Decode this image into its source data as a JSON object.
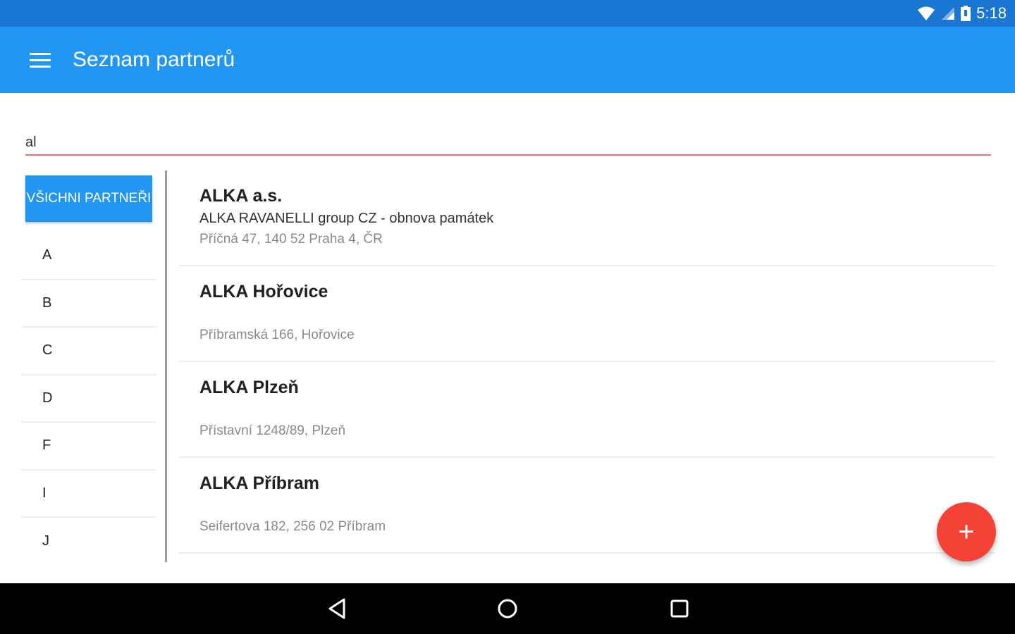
{
  "status_bar": {
    "time": "5:18",
    "icons": [
      "wifi-icon",
      "cellular-signal-icon",
      "battery-icon"
    ]
  },
  "toolbar": {
    "menu_icon": "hamburger-menu-icon",
    "title": "Seznam partnerů"
  },
  "search": {
    "value": "al",
    "placeholder": ""
  },
  "letters_panel": {
    "all_button": "VŠICHNI PARTNEŘI",
    "letters": [
      "A",
      "B",
      "C",
      "D",
      "F",
      "I",
      "J"
    ]
  },
  "partners": [
    {
      "name": "ALKA a.s.",
      "description": "ALKA RAVANELLI group CZ - obnova památek",
      "address": "Příčná 47, 140 52 Praha 4, ČR"
    },
    {
      "name": "ALKA Hořovice",
      "description": "",
      "address": "Příbramská 166,  Hořovice"
    },
    {
      "name": "ALKA Plzeň",
      "description": "",
      "address": "Přístavní 1248/89,  Plzeň"
    },
    {
      "name": "ALKA Příbram",
      "description": "",
      "address": "Seifertova 182, 256 02 Příbram"
    }
  ],
  "fab": {
    "icon": "plus-icon",
    "symbol": "+"
  },
  "nav_bar": {
    "icons": [
      "back-icon",
      "home-icon",
      "recents-icon"
    ]
  },
  "colors": {
    "status_bar": "#1976d2",
    "toolbar": "#2196f3",
    "accent": "#f44336",
    "search_underline": "#f0707a"
  }
}
